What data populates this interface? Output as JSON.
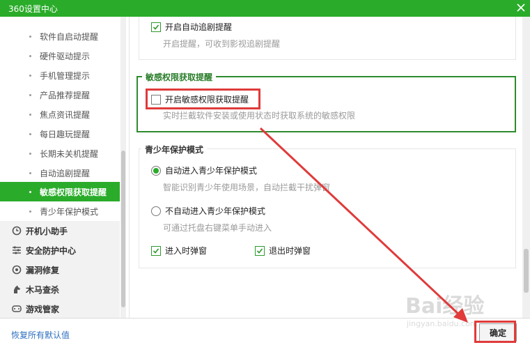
{
  "window": {
    "title": "360设置中心"
  },
  "sidebar": {
    "sub_items": [
      {
        "label": "软件自启动提醒",
        "active": false
      },
      {
        "label": "硬件驱动提示",
        "active": false
      },
      {
        "label": "手机管理提示",
        "active": false
      },
      {
        "label": "产品推荐提醒",
        "active": false
      },
      {
        "label": "焦点资讯提醒",
        "active": false
      },
      {
        "label": "每日趣玩提醒",
        "active": false
      },
      {
        "label": "长期未关机提醒",
        "active": false
      },
      {
        "label": "自动追剧提醒",
        "active": false
      },
      {
        "label": "敏感权限获取提醒",
        "active": true
      },
      {
        "label": "青少年保护模式",
        "active": false
      }
    ],
    "categories": [
      {
        "label": "开机小助手",
        "icon": "clock-icon"
      },
      {
        "label": "安全防护中心",
        "icon": "sliders-icon"
      },
      {
        "label": "漏洞修复",
        "icon": "patch-icon"
      },
      {
        "label": "木马查杀",
        "icon": "horse-icon"
      },
      {
        "label": "游戏管家",
        "icon": "gamepad-icon"
      }
    ]
  },
  "main": {
    "follow_drama": {
      "option_label": "开启自动追剧提醒",
      "checked": true,
      "description": "开启提醒，可收到影视追剧提醒"
    },
    "sensitive": {
      "title": "敏感权限获取提醒",
      "option_label": "开启敏感权限获取提醒",
      "checked": false,
      "description": "实时拦截软件安装或使用状态时获取系统的敏感权限"
    },
    "youth": {
      "title": "青少年保护模式",
      "auto_label": "自动进入青少年保护模式",
      "auto_desc": "智能识别青少年使用场景，自动拦截干扰弹窗",
      "manual_label": "不自动进入青少年保护模式",
      "manual_desc": "可通过托盘右键菜单手动进入",
      "selected": "auto",
      "enter_popup_label": "进入时弹窗",
      "enter_popup_checked": true,
      "exit_popup_label": "退出时弹窗",
      "exit_popup_checked": true
    }
  },
  "footer": {
    "restore_label": "恢复所有默认值",
    "ok_label": "确定"
  },
  "watermark": {
    "logo": "Bai经验",
    "url": "jingyan.baidu.com"
  },
  "colors": {
    "brand_green": "#2aac2a",
    "annotation_red": "#e03a3a",
    "link_blue": "#2e6fc0"
  }
}
